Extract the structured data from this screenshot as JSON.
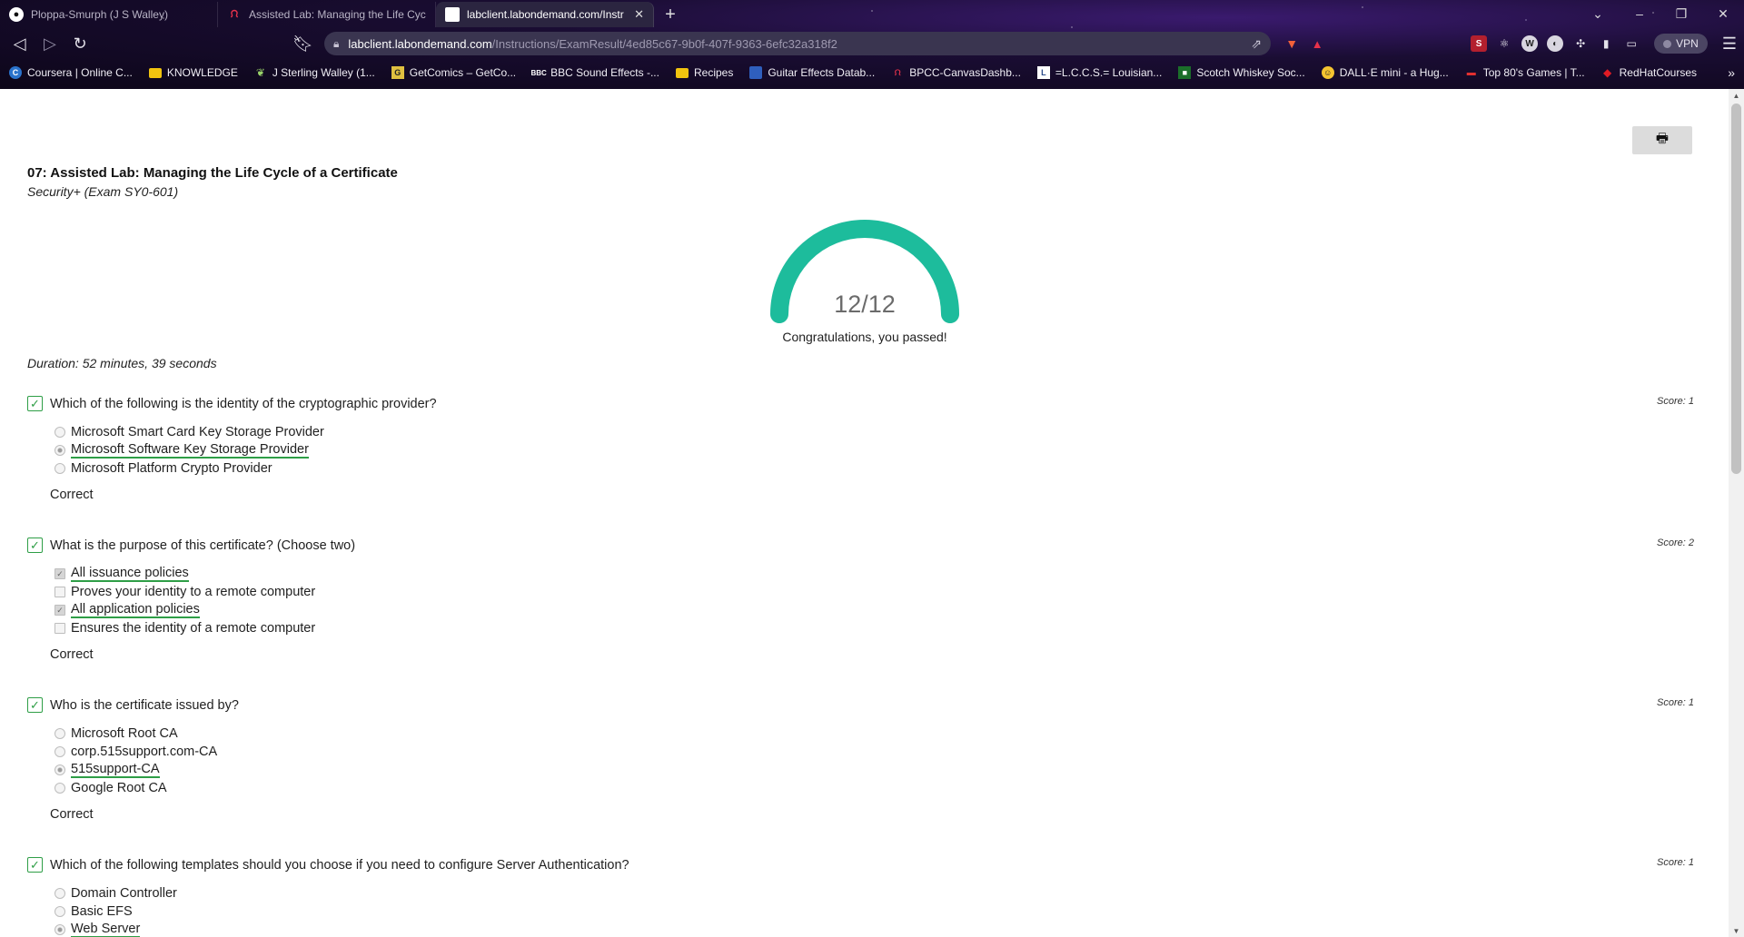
{
  "browser": {
    "tabs": [
      {
        "title": "Ploppa-Smurph (J S Walley)",
        "icon": "github-icon",
        "active": false
      },
      {
        "title": "Assisted Lab: Managing the Life Cycle",
        "icon": "red-bat-icon",
        "active": false
      },
      {
        "title": "labclient.labondemand.com/Instr",
        "icon": "document-icon",
        "active": true
      }
    ],
    "new_tab": "+",
    "url_host": "labclient.labondemand.com",
    "url_path": "/Instructions/ExamResult/4ed85c67-9b0f-407f-9363-6efc32a318f2",
    "vpn_label": "VPN",
    "bookmarks": [
      {
        "label": "Coursera | Online C...",
        "icon": "coursera-icon"
      },
      {
        "label": "KNOWLEDGE",
        "icon": "folder-icon"
      },
      {
        "label": "J Sterling Walley (1...",
        "icon": "leaf-icon"
      },
      {
        "label": "GetComics – GetCo...",
        "icon": "getcomics-icon"
      },
      {
        "label": "BBC Sound Effects -...",
        "icon": "bbc-icon"
      },
      {
        "label": "Recipes",
        "icon": "folder-icon"
      },
      {
        "label": "Guitar Effects Datab...",
        "icon": "page-icon"
      },
      {
        "label": "BPCC-CanvasDashb...",
        "icon": "red-bat-icon"
      },
      {
        "label": "=L.C.C.S.= Louisian...",
        "icon": "lccs-icon"
      },
      {
        "label": "Scotch Whiskey Soc...",
        "icon": "scotch-icon"
      },
      {
        "label": "DALL·E mini - a Hug...",
        "icon": "hugging-face-icon"
      },
      {
        "label": "Top 80's Games | T...",
        "icon": "top80-icon"
      },
      {
        "label": "RedHatCourses",
        "icon": "redhat-icon"
      }
    ],
    "bookmarks_more": "»"
  },
  "exam": {
    "title": "07: Assisted Lab: Managing the Life Cycle of a Certificate",
    "subtitle": "Security+ (Exam SY0-601)",
    "score": "12/12",
    "score_fraction": 1.0,
    "result_message": "Congratulations, you passed!",
    "duration": "Duration: 52 minutes, 39 seconds",
    "gauge_color": "#1dbc9c"
  },
  "questions": [
    {
      "text": "Which of the following is the identity of the cryptographic provider?",
      "score": "Score: 1",
      "type": "radio",
      "result": "Correct",
      "options": [
        {
          "label": "Microsoft Smart Card Key Storage Provider",
          "selected": false,
          "correct": false
        },
        {
          "label": "Microsoft Software Key Storage Provider",
          "selected": true,
          "correct": true
        },
        {
          "label": "Microsoft Platform Crypto Provider",
          "selected": false,
          "correct": false
        }
      ]
    },
    {
      "text": "What is the purpose of this certificate? (Choose two)",
      "score": "Score: 2",
      "type": "checkbox",
      "result": "Correct",
      "options": [
        {
          "label": "All issuance policies",
          "selected": true,
          "correct": true
        },
        {
          "label": "Proves your identity to a remote computer",
          "selected": false,
          "correct": false
        },
        {
          "label": "All application policies",
          "selected": true,
          "correct": true
        },
        {
          "label": "Ensures the identity of a remote computer",
          "selected": false,
          "correct": false
        }
      ]
    },
    {
      "text": "Who is the certificate issued by?",
      "score": "Score: 1",
      "type": "radio",
      "result": "Correct",
      "options": [
        {
          "label": "Microsoft Root CA",
          "selected": false,
          "correct": false
        },
        {
          "label": "corp.515support.com-CA",
          "selected": false,
          "correct": false
        },
        {
          "label": "515support-CA",
          "selected": true,
          "correct": true
        },
        {
          "label": "Google Root CA",
          "selected": false,
          "correct": false
        }
      ]
    },
    {
      "text": "Which of the following templates should you choose if you need to configure Server Authentication?",
      "score": "Score: 1",
      "type": "radio",
      "result": "",
      "options": [
        {
          "label": "Domain Controller",
          "selected": false,
          "correct": false
        },
        {
          "label": "Basic EFS",
          "selected": false,
          "correct": false
        },
        {
          "label": "Web Server",
          "selected": true,
          "correct": true
        }
      ]
    }
  ]
}
